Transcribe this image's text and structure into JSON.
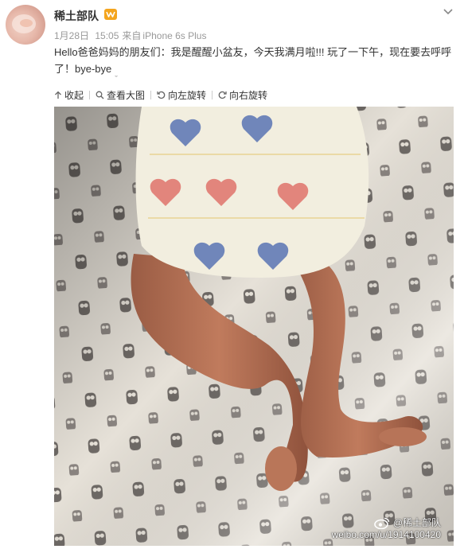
{
  "post": {
    "username": "稀土部队",
    "date": "1月28日",
    "time": "15:05",
    "source_prefix": "来自",
    "source_device": "iPhone 6s Plus",
    "text": "Hello爸爸妈妈的朋友们：我是醒醒小盆友，今天我满月啦!!! 玩了一下午，现在要去呼呼了！bye-bye"
  },
  "toolbar": {
    "collapse_label": "收起",
    "view_large_label": "查看大图",
    "rotate_left_label": "向左旋转",
    "rotate_right_label": "向右旋转"
  },
  "photo": {
    "watermark_name": "@稀土部队",
    "watermark_url": "weibo.com/u/1914100420"
  },
  "icons": {
    "badge": "vip-badge-icon",
    "menu": "chevron-down-icon",
    "collapse": "collapse-up-icon",
    "zoom": "magnifier-icon",
    "rotate_left": "rotate-left-icon",
    "rotate_right": "rotate-right-icon",
    "weibo": "weibo-logo-icon"
  },
  "colors": {
    "text": "#333333",
    "meta": "#999999",
    "badge": "#f4a51e"
  }
}
